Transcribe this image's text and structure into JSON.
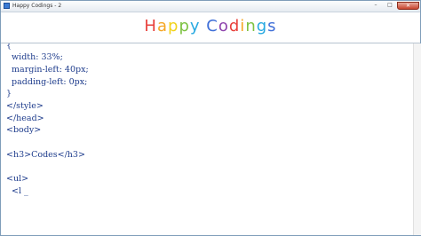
{
  "window": {
    "title": "Happy Codings - 2",
    "min_glyph": "–",
    "max_glyph": "□",
    "close_glyph": "✕"
  },
  "header": {
    "logo_text": "Happy Codings",
    "logo_letters": [
      {
        "char": "H",
        "color": "#e8413c"
      },
      {
        "char": "a",
        "color": "#f5a623"
      },
      {
        "char": "p",
        "color": "#f2d31b"
      },
      {
        "char": "p",
        "color": "#7dc242"
      },
      {
        "char": "y",
        "color": "#27a9e1"
      },
      {
        "char": " ",
        "color": "#ffffff"
      },
      {
        "char": "C",
        "color": "#3f6fd8"
      },
      {
        "char": "o",
        "color": "#8e44ad"
      },
      {
        "char": "d",
        "color": "#e8413c"
      },
      {
        "char": "i",
        "color": "#f5a623"
      },
      {
        "char": "n",
        "color": "#7dc242"
      },
      {
        "char": "g",
        "color": "#27a9e1"
      },
      {
        "char": "s",
        "color": "#3f6fd8"
      }
    ]
  },
  "editor": {
    "text_color": "#1e3c8c",
    "lines": [
      "{",
      "  width: 33%;",
      "  margin-left: 40px;",
      "  padding-left: 0px;",
      "}",
      "</style>",
      "</head>",
      "<body>",
      "",
      "<h3>Codes</h3>",
      "",
      "<ul>",
      "  <l _"
    ]
  }
}
